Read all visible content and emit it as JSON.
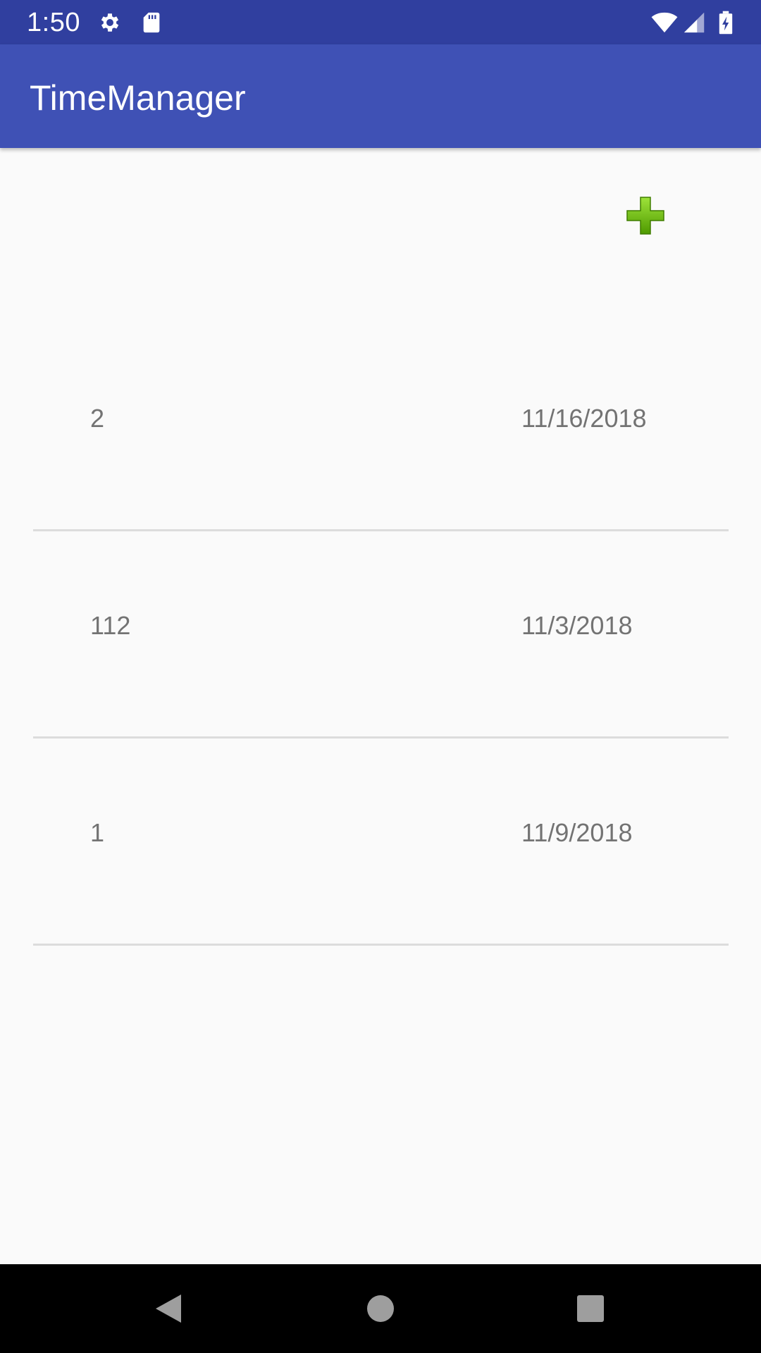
{
  "status_bar": {
    "time": "1:50",
    "icons": [
      "gear-icon",
      "sd-card-icon",
      "wifi-icon",
      "cell-signal-icon",
      "battery-charging-icon"
    ]
  },
  "app_bar": {
    "title": "TimeManager",
    "color": "#3f51b5",
    "status_color": "#303f9f"
  },
  "add_button": {
    "icon": "plus-icon",
    "color": "#6cbf00"
  },
  "list": {
    "items": [
      {
        "name": "2",
        "date": "11/16/2018"
      },
      {
        "name": "112",
        "date": "11/3/2018"
      },
      {
        "name": "1",
        "date": "11/9/2018"
      }
    ]
  },
  "nav_bar": {
    "icons": [
      "back-icon",
      "home-icon",
      "recents-icon"
    ]
  }
}
